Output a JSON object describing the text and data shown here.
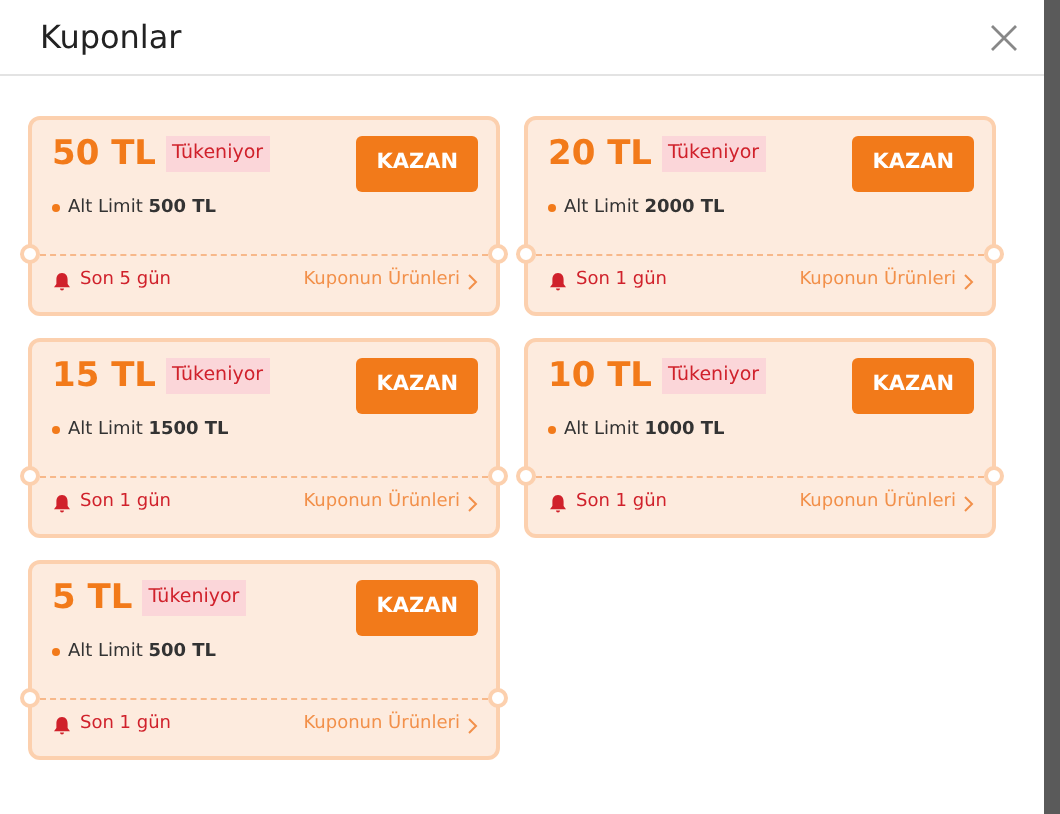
{
  "modal": {
    "title": "Kuponlar"
  },
  "coupons": [
    {
      "amount": "50 TL",
      "badge": "Tükeniyor",
      "button": "KAZAN",
      "limit": "Alt Limit **500 TL**",
      "days": "Son 5 gün",
      "link": "Kuponun Ürünleri"
    },
    {
      "amount": "20 TL",
      "badge": "Tükeniyor",
      "button": "KAZAN",
      "limit": "Alt Limit **2000 TL**",
      "days": "Son 1 gün",
      "link": "Kuponun Ürünleri"
    },
    {
      "amount": "15 TL",
      "badge": "Tükeniyor",
      "button": "KAZAN",
      "limit": "Alt Limit **1500 TL**",
      "days": "Son 1 gün",
      "link": "Kuponun Ürünleri"
    },
    {
      "amount": "10 TL",
      "badge": "Tükeniyor",
      "button": "KAZAN",
      "limit": "Alt Limit **1000 TL**",
      "days": "Son 1 gün",
      "link": "Kuponun Ürünleri"
    },
    {
      "amount": "5 TL",
      "badge": "Tükeniyor",
      "button": "KAZAN",
      "limit": "Alt Limit **500 TL**",
      "days": "Son 1 gün",
      "link": "Kuponun Ürünleri"
    }
  ]
}
